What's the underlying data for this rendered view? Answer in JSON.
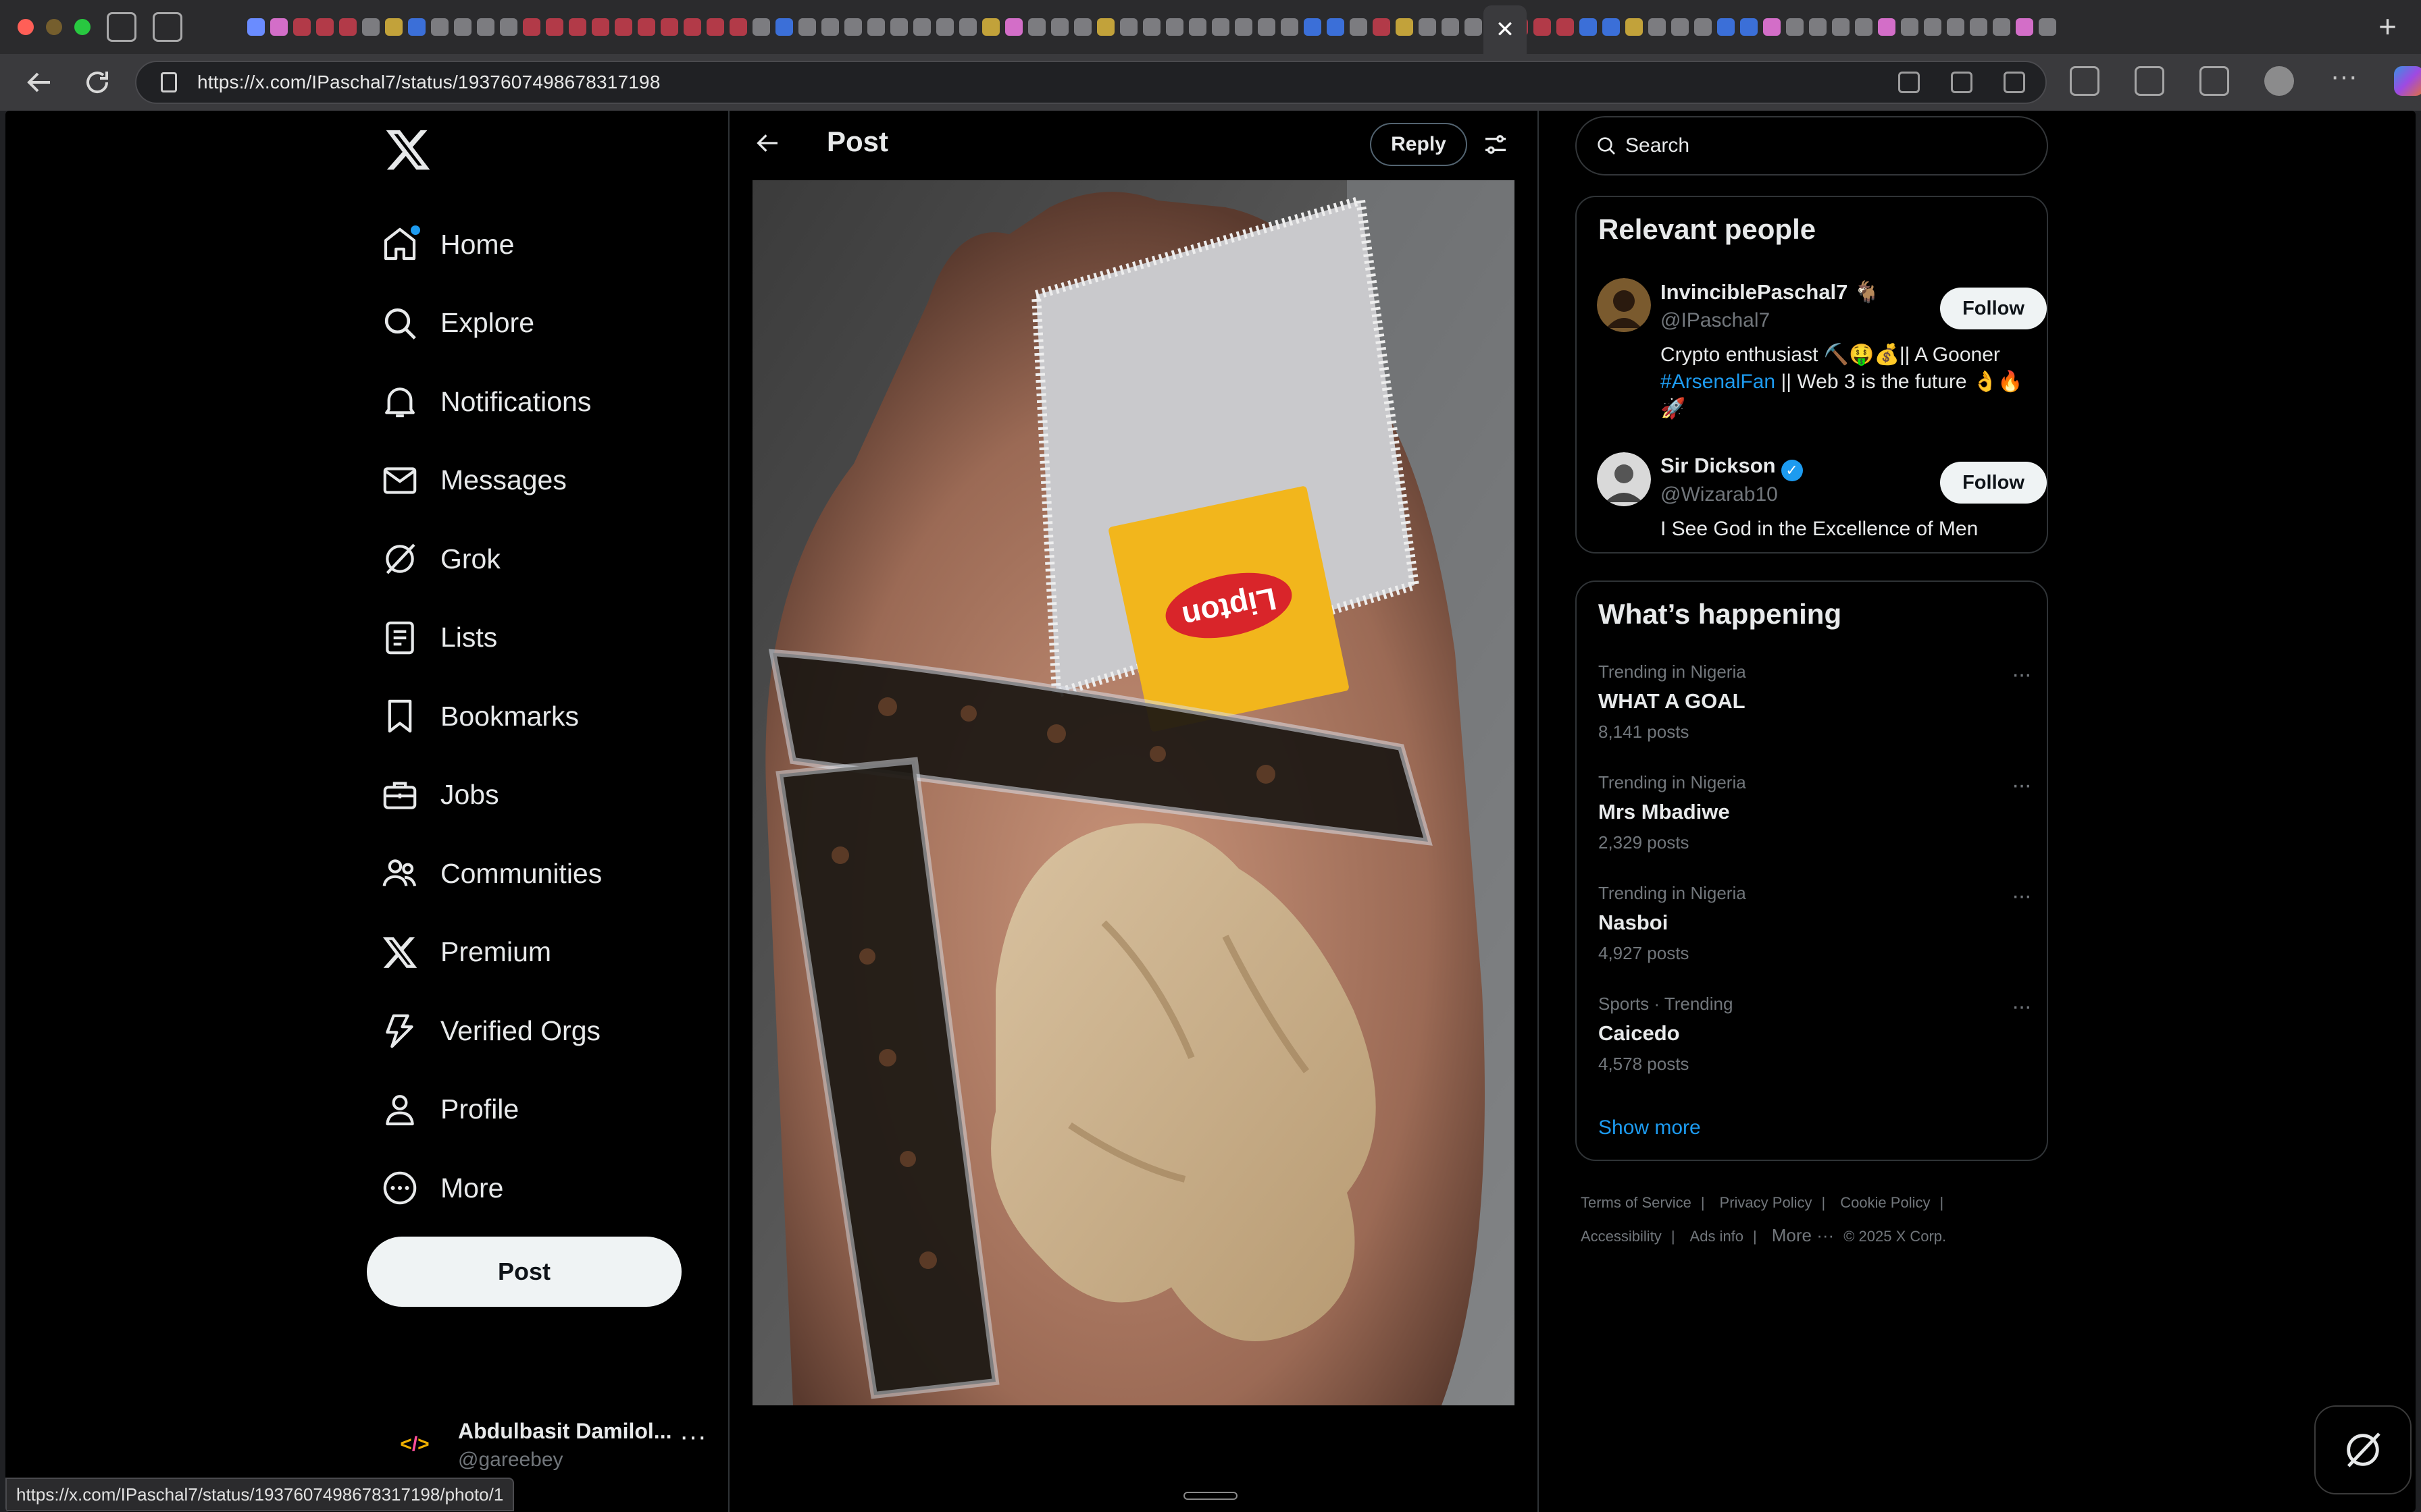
{
  "browser": {
    "url": "https://x.com/IPaschal7/status/1937607498678317198",
    "status_url": "https://x.com/IPaschal7/status/1937607498678317198/photo/1",
    "active_tab_close": "✕",
    "new_tab": "+"
  },
  "nav": {
    "items": [
      {
        "label": "Home",
        "icon": "home-icon"
      },
      {
        "label": "Explore",
        "icon": "search-icon"
      },
      {
        "label": "Notifications",
        "icon": "bell-icon"
      },
      {
        "label": "Messages",
        "icon": "mail-icon"
      },
      {
        "label": "Grok",
        "icon": "grok-icon"
      },
      {
        "label": "Lists",
        "icon": "list-icon"
      },
      {
        "label": "Bookmarks",
        "icon": "bookmark-icon"
      },
      {
        "label": "Jobs",
        "icon": "briefcase-icon"
      },
      {
        "label": "Communities",
        "icon": "people-icon"
      },
      {
        "label": "Premium",
        "icon": "x-icon"
      },
      {
        "label": "Verified Orgs",
        "icon": "lightning-icon"
      },
      {
        "label": "Profile",
        "icon": "person-icon"
      },
      {
        "label": "More",
        "icon": "more-circle-icon"
      }
    ],
    "post_button": "Post"
  },
  "account": {
    "name": "Abdulbasit Damilol...",
    "handle": "@gareebey",
    "more": "···"
  },
  "post": {
    "title": "Post",
    "reply_button": "Reply"
  },
  "search": {
    "placeholder": "Search"
  },
  "relevant_people": {
    "title": "Relevant people",
    "people": [
      {
        "name": "InvinciblePaschal7 🐐",
        "handle": "@IPaschal7",
        "bio_1": "Crypto enthusiast ⛏️🤑💰|| A Gooner ",
        "bio_hash": "#ArsenalFan",
        "bio_2": " || Web 3 is the future 👌🔥🚀",
        "follow": "Follow"
      },
      {
        "name": "Sir Dickson",
        "handle": "@Wizarab10",
        "bio": "I See God in the Excellence of Men",
        "follow": "Follow",
        "verified_mark": "✓"
      }
    ]
  },
  "whats_happening": {
    "title": "What’s happening",
    "trends": [
      {
        "context": "Trending in Nigeria",
        "name": "WHAT A GOAL",
        "count": "8,141 posts"
      },
      {
        "context": "Trending in Nigeria",
        "name": "Mrs Mbadiwe",
        "count": "2,329 posts"
      },
      {
        "context": "Trending in Nigeria",
        "name": "Nasboi",
        "count": "4,927 posts"
      },
      {
        "context": "Sports · Trending",
        "name": "Caicedo",
        "count": "4,578 posts"
      }
    ],
    "trend_more": "···",
    "show_more": "Show more"
  },
  "footer": {
    "links": [
      "Terms of Service",
      "Privacy Policy",
      "Cookie Policy",
      "Accessibility",
      "Ads info"
    ],
    "separator": "|",
    "more": "More ···",
    "copyright": "© 2025 X Corp."
  },
  "photo": {
    "pack_text": "Lipton"
  },
  "colors": {
    "accent": "#1d9bf0",
    "background": "#000000",
    "muted": "#71767b"
  }
}
